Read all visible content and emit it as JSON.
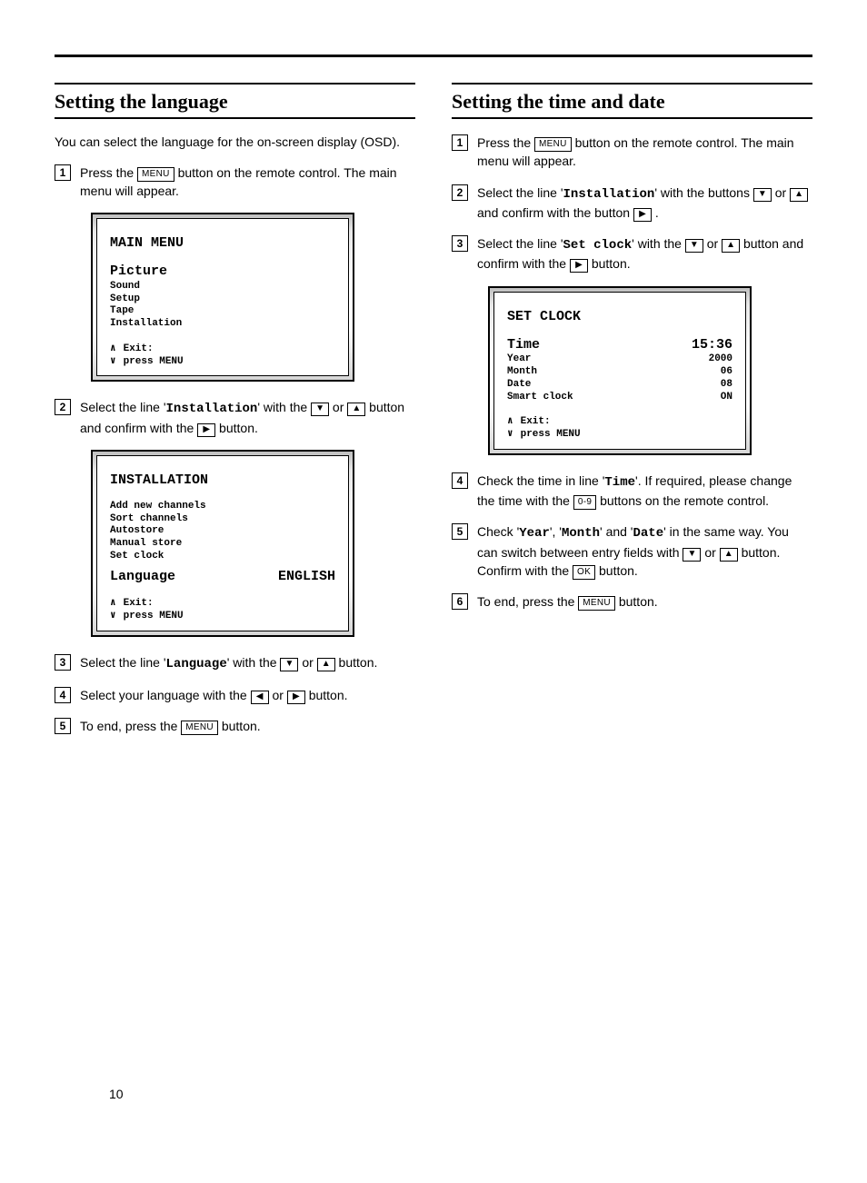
{
  "page_number": "10",
  "buttons": {
    "menu": "MENU",
    "ok": "OK",
    "digits": "0-9"
  },
  "left": {
    "heading": "Setting the language",
    "intro": "You can select the language for the on-screen display (OSD).",
    "step1_a": "Press the ",
    "step1_b": " button on the remote control. The main menu will appear.",
    "osd1": {
      "title": "MAIN MENU",
      "highlight": "Picture",
      "items": [
        "Sound",
        "Setup",
        "Tape",
        "Installation"
      ],
      "exit1": "Exit:",
      "exit2": "press MENU"
    },
    "step2_a": "Select the line '",
    "step2_mono": "Installation",
    "step2_b": "' with the ",
    "step2_c": " or ",
    "step2_d": " button and confirm with the ",
    "step2_e": " button.",
    "osd2": {
      "title": "INSTALLATION",
      "items": [
        "Add new channels",
        "Sort channels",
        "Autostore",
        "Manual store",
        "Set clock"
      ],
      "lang_label": "Language",
      "lang_value": "ENGLISH",
      "exit1": "Exit:",
      "exit2": "press MENU"
    },
    "step3_a": "Select the line '",
    "step3_mono": "Language",
    "step3_b": "' with the ",
    "step3_c": " or ",
    "step3_d": " button.",
    "step4_a": "Select your language with the ",
    "step4_b": " or ",
    "step4_c": " button.",
    "step5_a": "To end, press the ",
    "step5_b": " button."
  },
  "right": {
    "heading": "Setting the time and date",
    "step1_a": "Press the ",
    "step1_b": " button on the remote control. The main menu will appear.",
    "step2_a": "Select the line '",
    "step2_mono": "Installation",
    "step2_b": "' with the buttons ",
    "step2_c": " or ",
    "step2_d": " and confirm with the button ",
    "step2_e": " .",
    "step3_a": "Select the line '",
    "step3_mono": "Set clock",
    "step3_b": "' with the ",
    "step3_c": " or ",
    "step3_d": " button and confirm with the ",
    "step3_e": " button.",
    "osd": {
      "title": "SET CLOCK",
      "rows": [
        {
          "label": "Time",
          "value": "15:36",
          "big": true
        },
        {
          "label": "Year",
          "value": "2000"
        },
        {
          "label": "Month",
          "value": "06"
        },
        {
          "label": "Date",
          "value": "08"
        },
        {
          "label": "Smart clock",
          "value": "ON"
        }
      ],
      "exit1": "Exit:",
      "exit2": "press MENU"
    },
    "step4_a": "Check the time in line '",
    "step4_mono": "Time",
    "step4_b": "'. If required, please change the time with the ",
    "step4_c": " buttons on the remote control.",
    "step5_a": "Check '",
    "step5_m1": "Year",
    "step5_b": "', '",
    "step5_m2": "Month",
    "step5_c": "' and '",
    "step5_m3": "Date",
    "step5_d": "' in the same way. You can switch between entry fields with ",
    "step5_e": " or ",
    "step5_f": " button. Confirm with the ",
    "step5_g": " button.",
    "step6_a": "To end, press the ",
    "step6_b": " button."
  }
}
